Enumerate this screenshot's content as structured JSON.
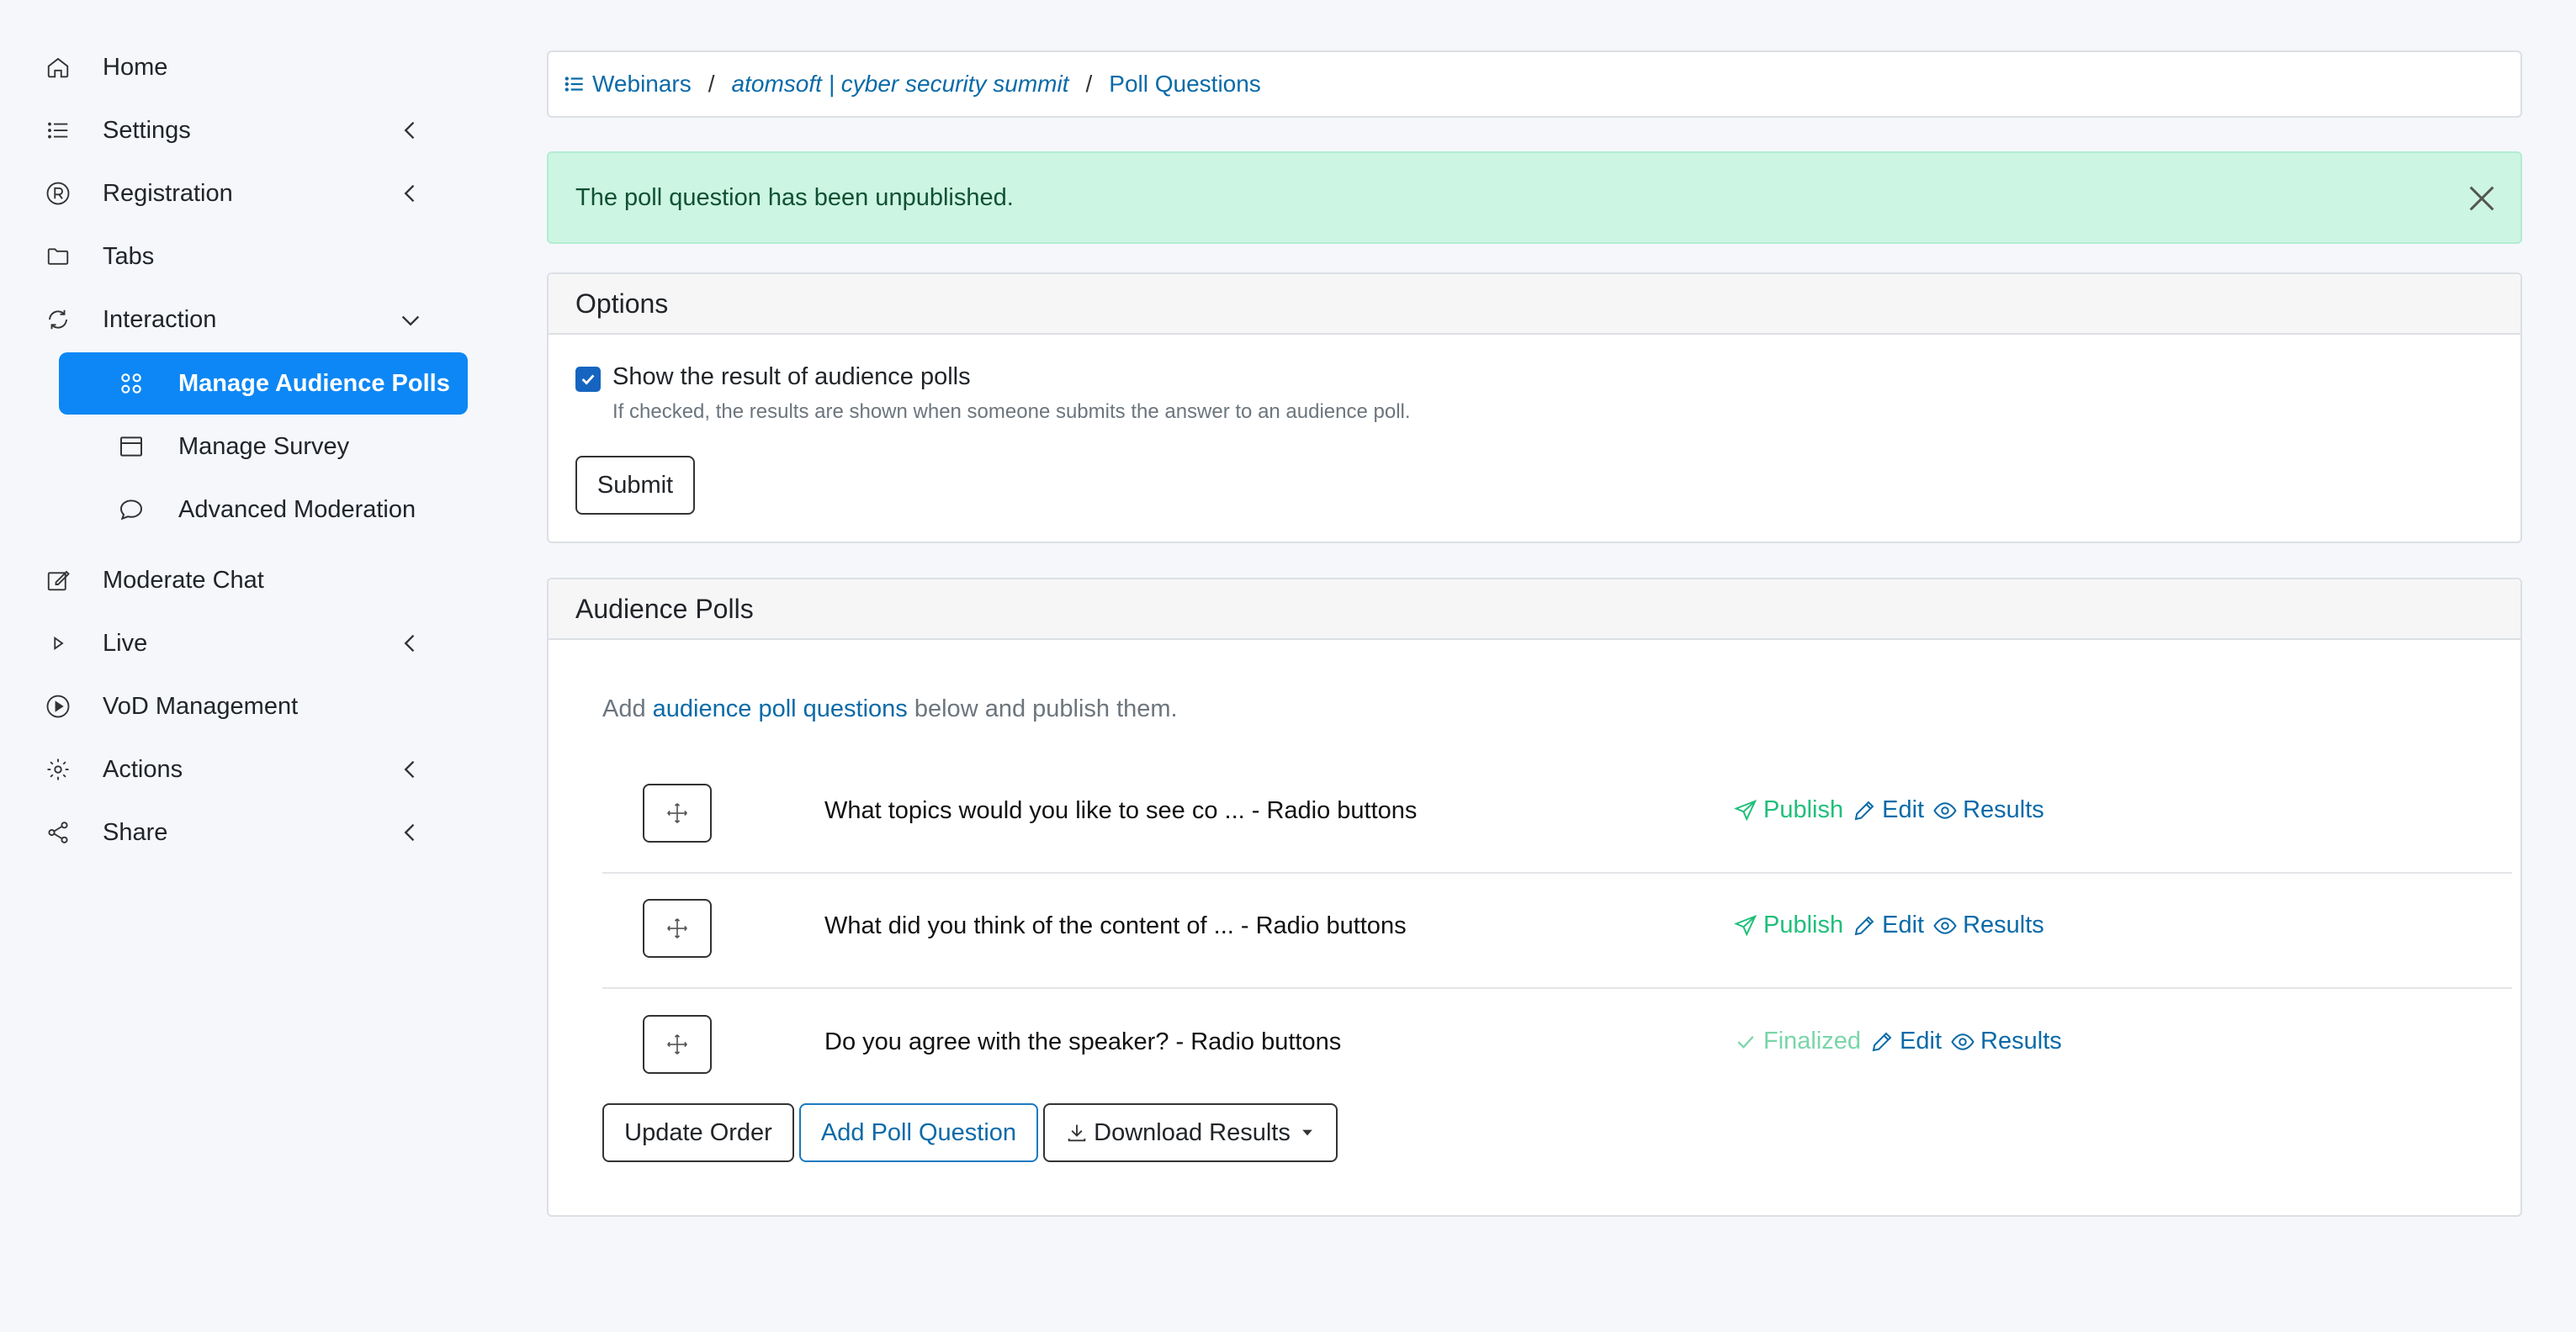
{
  "sidebar": {
    "items": [
      {
        "label": "Home",
        "icon": "home-icon"
      },
      {
        "label": "Settings",
        "icon": "list-icon",
        "chevron": "chevron-left"
      },
      {
        "label": "Registration",
        "icon": "registered-icon",
        "chevron": "chevron-left"
      },
      {
        "label": "Tabs",
        "icon": "folder-icon"
      },
      {
        "label": "Interaction",
        "icon": "refresh-icon",
        "chevron": "chevron-down"
      },
      {
        "label": "Moderate Chat",
        "icon": "edit-icon"
      },
      {
        "label": "Live",
        "icon": "play-icon",
        "chevron": "chevron-left"
      },
      {
        "label": "VoD Management",
        "icon": "play-circle-icon"
      },
      {
        "label": "Actions",
        "icon": "gear-icon",
        "chevron": "chevron-left"
      },
      {
        "label": "Share",
        "icon": "share-icon",
        "chevron": "chevron-left"
      }
    ],
    "subitems": [
      {
        "label": "Manage Audience Polls",
        "icon": "poll-grid-icon",
        "active": true
      },
      {
        "label": "Manage Survey",
        "icon": "browser-icon"
      },
      {
        "label": "Advanced Moderation",
        "icon": "chat-bubble-icon"
      }
    ],
    "active_color": "#0d87f5"
  },
  "breadcrumb": {
    "root": "Webinars",
    "event": "atomsoft | cyber security summit",
    "current": "Poll Questions",
    "separator": "/"
  },
  "alert": {
    "message": "The poll question has been unpublished."
  },
  "options": {
    "title": "Options",
    "checkbox_label": "Show the result of audience polls",
    "checkbox_checked": true,
    "help_text": "If checked, the results are shown when someone submits the answer to an audience poll.",
    "submit_label": "Submit"
  },
  "polls": {
    "title": "Audience Polls",
    "intro_prefix": "Add",
    "intro_link": "audience poll questions",
    "intro_suffix": "below and publish them.",
    "questions": [
      {
        "text": "What topics would you like to see co ... - Radio buttons",
        "status": "Publish",
        "edit": "Edit",
        "results": "Results"
      },
      {
        "text": "What did you think of the content of ... - Radio buttons",
        "status": "Publish",
        "edit": "Edit",
        "results": "Results"
      },
      {
        "text": "Do you agree with the speaker? - Radio buttons",
        "status": "Finalized",
        "edit": "Edit",
        "results": "Results"
      }
    ],
    "buttons": {
      "update_order": "Update Order",
      "add_question": "Add Poll Question",
      "download_results": "Download Results"
    }
  }
}
